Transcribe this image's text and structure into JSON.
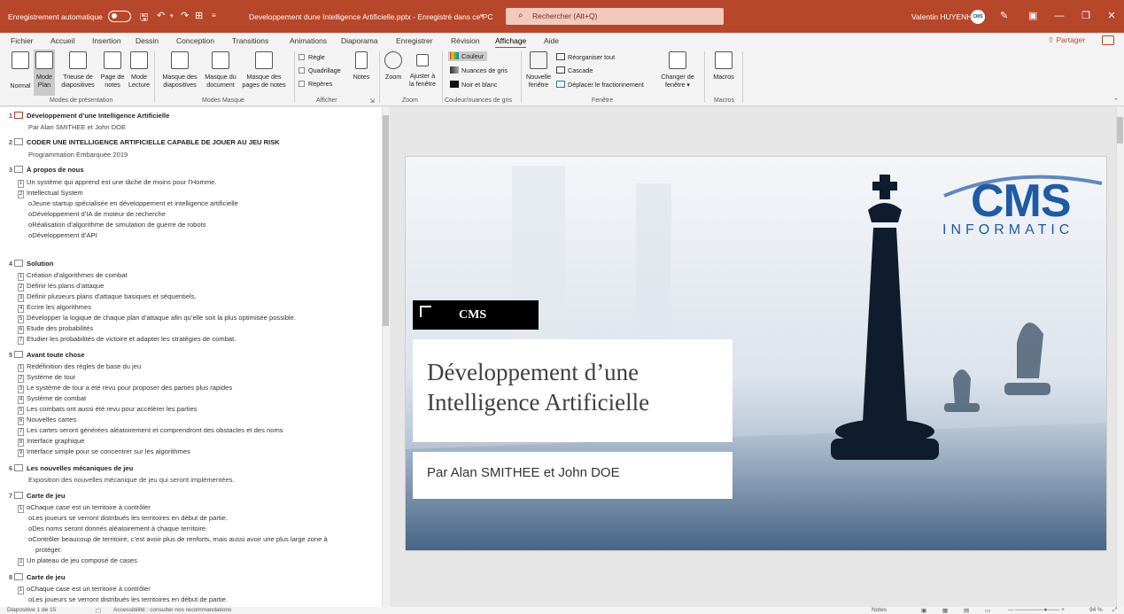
{
  "titlebar": {
    "autosave_label": "Enregistrement automatique",
    "doc_title": "Developpement dune Intelligence Artificielle.pptx - Enregistré dans ce PC",
    "search_placeholder": "Rechercher (Alt+Q)",
    "user": "Valentin HUYENH",
    "avatar_text": "CMS"
  },
  "menu": [
    "Fichier",
    "Accueil",
    "Insertion",
    "Dessin",
    "Conception",
    "Transitions",
    "Animations",
    "Diaporama",
    "Enregistrer",
    "Révision",
    "Affichage",
    "Aide"
  ],
  "menu_active": "Affichage",
  "share_label": "Partager",
  "ribbon": {
    "modes_presentation": {
      "normal": "Normal",
      "mode_plan_1": "Mode",
      "mode_plan_2": "Plan",
      "trieuse_1": "Trieuse de",
      "trieuse_2": "diapositives",
      "page_notes_1": "Page de",
      "page_notes_2": "notes",
      "lecture_1": "Mode",
      "lecture_2": "Lecture",
      "group": "Modes de présentation"
    },
    "modes_masque": {
      "masque_diapo_1": "Masque des",
      "masque_diapo_2": "diapositives",
      "masque_doc_1": "Masque du",
      "masque_doc_2": "document",
      "masque_notes_1": "Masque des",
      "masque_notes_2": "pages de notes",
      "group": "Modes Masque"
    },
    "afficher": {
      "regle": "Règle",
      "quadrillage": "Quadrillage",
      "reperes": "Repères",
      "notes": "Notes",
      "group": "Afficher"
    },
    "zoom": {
      "zoom": "Zoom",
      "ajuster_1": "Ajuster à",
      "ajuster_2": "la fenêtre",
      "group": "Zoom"
    },
    "couleur": {
      "couleur": "Couleur",
      "nuances": "Nuances de gris",
      "noir_blanc": "Noir et blanc",
      "group": "Couleur/nuances de gris"
    },
    "fenetre": {
      "nouvelle_1": "Nouvelle",
      "nouvelle_2": "fenêtre",
      "reorganiser": "Réorganiser tout",
      "cascade": "Cascade",
      "deplacer": "Déplacer le fractionnement",
      "changer_1": "Changer de",
      "changer_2": "fenêtre",
      "group": "Fenêtre"
    },
    "macros": {
      "macros": "Macros",
      "group": "Macros"
    }
  },
  "outline": {
    "s1_num": "1",
    "s1_title": "Développement d’une Intelligence Artificielle",
    "s1_sub": "Par Alan SMITHEE et John DOE",
    "s2_num": "2",
    "s2_title": "CODER UNE INTELLIGENCE ARTIFICIELLE CAPABLE DE JOUER AU JEU RISK",
    "s2_sub": "Programmation Embarquée 2019",
    "s3_num": "3",
    "s3_title": "À propos de nous",
    "s3_l1": "Un système qui apprend est une tâche de moins pour l’Homme.",
    "s3_l2": "Intellectual System",
    "s3_l3": "Jeune startup spécialisée en développement et intelligence artificielle",
    "s3_l4": "Développement d’IA de moteur de recherche",
    "s3_l5": "Réalisation d’algorithme de simulation de guerre de robots",
    "s3_l6": "Développement d’API",
    "s4_num": "4",
    "s4_title": "Solution",
    "s4_l1": "Création d’algorithmes de combat",
    "s4_l2": "Définir les plans d’attaque",
    "s4_l3": "Définir plusieurs plans d’attaque basiques et séquentiels.",
    "s4_l4": "Ecrire les algorithmes",
    "s4_l5": "Développer la logique de chaque plan d’attaque afin qu’elle soit la plus optimisée possible.",
    "s4_l6": "Etude des probabilités",
    "s4_l7": "Etudier les probabilités de victoire et adapter les stratégies de combat.",
    "s5_num": "5",
    "s5_title": "Avant toute chose",
    "s5_l1": "Redéfinition des règles de base du jeu",
    "s5_l2": "Système de tour",
    "s5_l3": "Le système de tour a été revu pour proposer des parties plus rapides",
    "s5_l4": "Système de combat",
    "s5_l5": "Les combats ont aussi été revu pour accélérer les parties",
    "s5_l6": "Nouvelles cartes",
    "s5_l7": "Les cartes seront générées aléatoirement et comprendront des obstacles et des noms",
    "s5_l8": "Interface graphique",
    "s5_l9": "Interface simple pour se concentrer sur les algorithmes",
    "s6_num": "6",
    "s6_title": "Les nouvelles mécaniques de jeu",
    "s6_sub": "Exposition des nouvelles mécanique de jeu qui seront implémentées.",
    "s7_num": "7",
    "s7_title": "Carte de jeu",
    "s7_l1": "Chaque case est un territoire à contrôler",
    "s7_l2": "Les joueurs se verront distribués les territoires en début de partie.",
    "s7_l3": "Des noms seront donnés aléatoirement à chaque territoire.",
    "s7_l4a": "Contrôler beaucoup de territoire, c’est avoir plus de renforts, mais aussi avoir une plus large zone à",
    "s7_l4b": "protéger.",
    "s7_l5": "Un plateau de jeu composé de cases",
    "s8_num": "8",
    "s8_title": "Carte de jeu",
    "s8_l1": "Chaque case est un territoire à contrôler",
    "s8_l2": "Les joueurs se verront distribués les territoires en début de partie.",
    "b1": "1",
    "b2": "2",
    "b3": "3",
    "b4": "4",
    "b5": "5",
    "b6": "6",
    "b7": "7",
    "b8": "8",
    "b9": "9"
  },
  "slide": {
    "tag": "CMS",
    "title_l1": "Développement d’une",
    "title_l2": "Intelligence Artificielle",
    "subtitle": "Par Alan SMITHEE et John DOE",
    "logo_top": "CMS",
    "logo_bottom": "INFORMATIC"
  },
  "status": {
    "slide_info": "Diapositive 1 de 15",
    "accessibility": "Accessibilité : consulter nos recommandations",
    "notes": "Notes",
    "zoom": "94 %"
  },
  "colors": {
    "accent": "#b7472a",
    "logo_blue": "#1f5aa6"
  }
}
